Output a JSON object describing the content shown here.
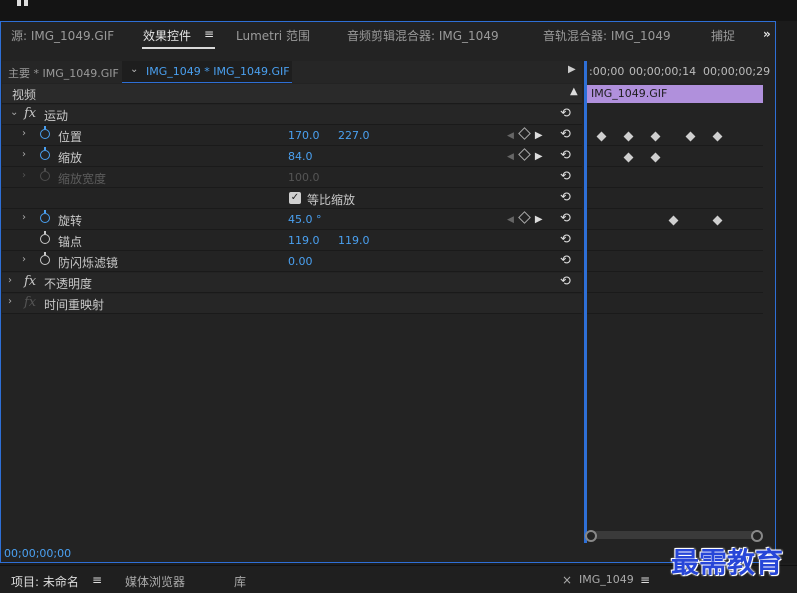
{
  "topbar": {
    "right_text1": "…",
    "right_text2": "…"
  },
  "tabs": [
    {
      "label": "源: IMG_1049.GIF"
    },
    {
      "label": "效果控件"
    },
    {
      "label": "Lumetri 范围"
    },
    {
      "label": "音频剪辑混合器: IMG_1049"
    },
    {
      "label": "音轨混合器: IMG_1049"
    },
    {
      "label": "捕捉"
    }
  ],
  "tab_menu_icon": "≡",
  "tab_more": "»",
  "subtabs": {
    "master": "主要 * IMG_1049.GIF",
    "clip": "IMG_1049 * IMG_1049.GIF"
  },
  "sections": {
    "video": "视频",
    "motion": "运动",
    "opacity": "不透明度",
    "time_remap": "时间重映射"
  },
  "fx_label": "fx",
  "properties": {
    "position": {
      "label": "位置",
      "x": "170.0",
      "y": "227.0"
    },
    "scale": {
      "label": "缩放",
      "value": "84.0"
    },
    "scale_width": {
      "label": "缩放宽度",
      "value": "100.0"
    },
    "uniform_scale": {
      "label": "等比缩放"
    },
    "rotation": {
      "label": "旋转",
      "value": "45.0 °"
    },
    "anchor": {
      "label": "锚点",
      "x": "119.0",
      "y": "119.0"
    },
    "flicker": {
      "label": "防闪烁滤镜",
      "value": "0.00"
    }
  },
  "timeline": {
    "tc1": ":00;00",
    "tc2": "00;00;00;14",
    "tc3": "00;00;00;29",
    "clip_name": "IMG_1049.GIF"
  },
  "status_timecode": "00;00;00;00",
  "bottom_tabs": [
    {
      "label": "项目: 未命名"
    },
    {
      "label": "媒体浏览器"
    },
    {
      "label": "库"
    },
    {
      "label": "IMG_1049"
    }
  ],
  "close_glyph": "×",
  "watermark": "最需教育",
  "colors": {
    "accent": "#2e6fd6",
    "value_blue": "#4aa0f0",
    "clip_purple": "#b090dc"
  }
}
